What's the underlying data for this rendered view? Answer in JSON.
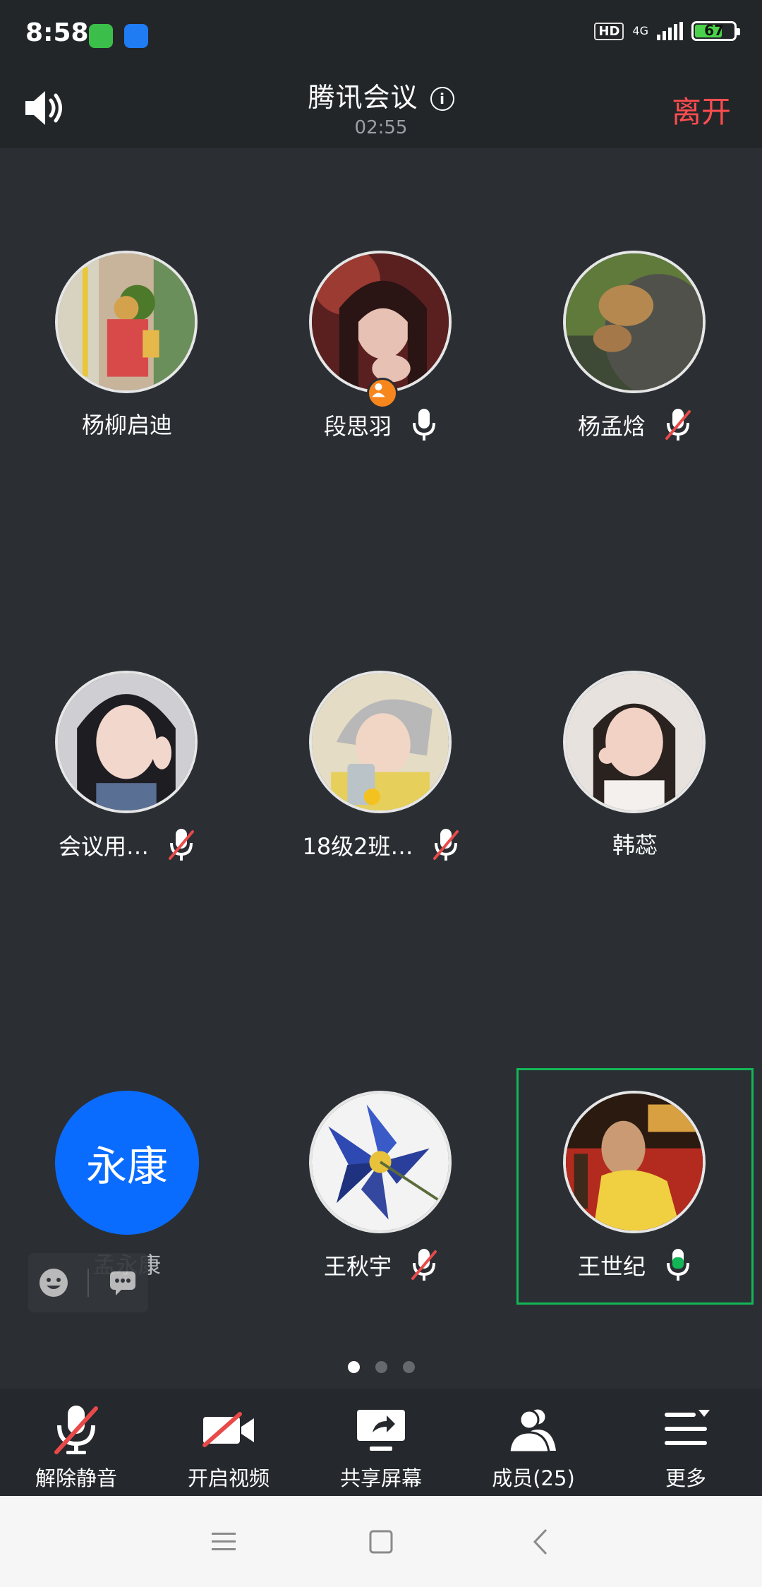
{
  "status_bar": {
    "time": "8:58",
    "hd_label": "HD",
    "network_label": "4G",
    "battery_level": "67",
    "colors": {
      "battery_fill": "#4ad24a"
    }
  },
  "header": {
    "title": "腾讯会议",
    "timer": "02:55",
    "leave_label": "离开",
    "icons": {
      "speaker": "speaker-icon",
      "info": "info-icon"
    }
  },
  "participants": [
    {
      "name": "杨柳启迪",
      "mic": "none",
      "avatar": "photo"
    },
    {
      "name": "段思羽",
      "mic": "on",
      "avatar": "photo",
      "host": true
    },
    {
      "name": "杨孟焓",
      "mic": "muted",
      "avatar": "photo"
    },
    {
      "name": "会议用…",
      "mic": "muted",
      "avatar": "photo"
    },
    {
      "name": "18级2班…",
      "mic": "muted",
      "avatar": "photo"
    },
    {
      "name": "韩蕊",
      "mic": "none",
      "avatar": "photo"
    },
    {
      "name": "孟永康",
      "mic": "none",
      "avatar": "text",
      "avatar_text": "永康"
    },
    {
      "name": "王秋宇",
      "mic": "muted",
      "avatar": "photo"
    },
    {
      "name": "王世纪",
      "mic": "speaking",
      "avatar": "photo",
      "active_speaker": true
    }
  ],
  "pager": {
    "pages": 3,
    "current": 1
  },
  "toolbar": {
    "unmute_label": "解除静音",
    "video_label": "开启视频",
    "share_label": "共享屏幕",
    "members_label": "成员(25)",
    "more_label": "更多"
  },
  "colors": {
    "accent_leave": "#ff4d4f",
    "speaking_green": "#13b656",
    "text_avatar_blue": "#0a6cff",
    "muted_red": "#e84a4a"
  }
}
